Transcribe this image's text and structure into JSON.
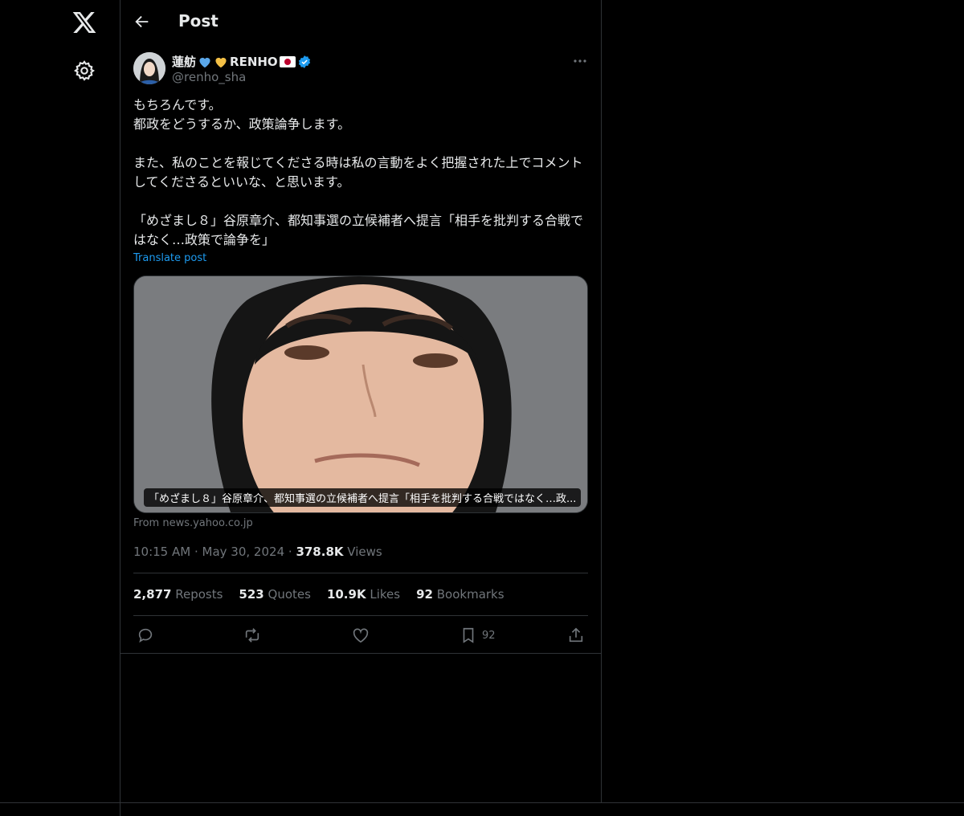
{
  "header": {
    "title": "Post"
  },
  "nav": {
    "logo_icon": "x-logo-icon",
    "settings_icon": "gear-icon"
  },
  "author": {
    "name": "蓮舫",
    "name_suffix": "RENHO",
    "handle": "@renho_sha",
    "verified": true
  },
  "tweet": {
    "text": "もちろんです。\n都政をどうするか、政策論争します。\n\nまた、私のことを報じてくださる時は私の言動をよく把握された上でコメントしてくださるといいな、と思います。\n\n「めざまし８」谷原章介、都知事選の立候補者へ提言「相手を批判する合戦ではなく…政策で論争を」",
    "translate_label": "Translate post"
  },
  "card": {
    "caption": "「めざまし８」谷原章介、都知事選の立候補者へ提言「相手を批判する合戦ではなく…政...",
    "source": "From news.yahoo.co.jp"
  },
  "meta": {
    "time": "10:15 AM",
    "date": "May 30, 2024",
    "views_count": "378.8K",
    "views_label": "Views"
  },
  "stats": {
    "reposts_count": "2,877",
    "reposts_label": "Reposts",
    "quotes_count": "523",
    "quotes_label": "Quotes",
    "likes_count": "10.9K",
    "likes_label": "Likes",
    "bookmarks_count": "92",
    "bookmarks_label": "Bookmarks"
  },
  "actions": {
    "bookmark_count": "92"
  },
  "colors": {
    "background": "#000000",
    "text": "#e7e9ea",
    "muted": "#71767b",
    "link": "#1d9bf0",
    "verified": "#1d9bf0"
  }
}
